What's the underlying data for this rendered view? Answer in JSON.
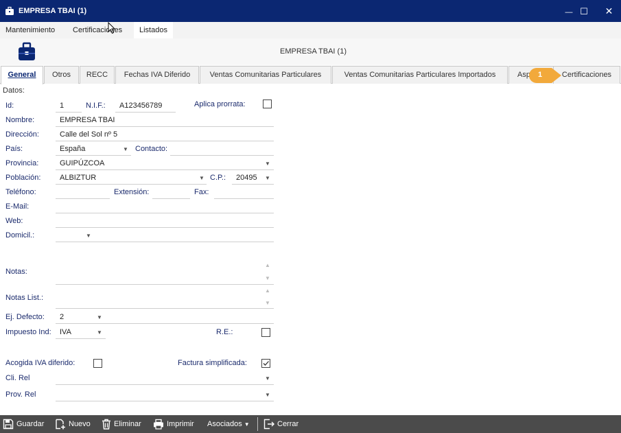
{
  "window": {
    "title": "EMPRESA TBAI (1)",
    "minimize_glyph": "—",
    "maximize_glyph": "☐",
    "close_glyph": "✕"
  },
  "menu": [
    "Mantenimiento",
    "Certificaciones",
    "Listados"
  ],
  "header": {
    "title": "EMPRESA TBAI (1)",
    "icon": "briefcase-icon"
  },
  "tabs": [
    {
      "label": "General",
      "active": true
    },
    {
      "label": "Otros"
    },
    {
      "label": "RECC"
    },
    {
      "label": "Fechas IVA Diferido"
    },
    {
      "label": "Ventas Comunitarias Particulares"
    },
    {
      "label": "Ventas Comunitarias Particulares Importados"
    },
    {
      "label": "Asp"
    },
    {
      "label": "Certificaciones"
    }
  ],
  "badge": {
    "number": "1",
    "color": "#f2a93b"
  },
  "form": {
    "section_label": "Datos:",
    "id": {
      "label": "Id:",
      "value": "1"
    },
    "nif": {
      "label": "N.I.F.:",
      "value": "A123456789"
    },
    "aplica_prorrata": {
      "label": "Aplica prorrata:",
      "checked": false
    },
    "nombre": {
      "label": "Nombre:",
      "value": "EMPRESA TBAI"
    },
    "direccion": {
      "label": "Dirección:",
      "value": "Calle del Sol nº 5"
    },
    "pais": {
      "label": "País:",
      "value": "España"
    },
    "contacto": {
      "label": "Contacto:",
      "value": ""
    },
    "provincia": {
      "label": "Provincia:",
      "value": "GUIPÚZCOA"
    },
    "poblacion": {
      "label": "Población:",
      "value": "ALBIZTUR"
    },
    "cp": {
      "label": "C.P.:",
      "value": "20495"
    },
    "telefono": {
      "label": "Teléfono:",
      "value": ""
    },
    "extension": {
      "label": "Extensión:",
      "value": ""
    },
    "fax": {
      "label": "Fax:",
      "value": ""
    },
    "email": {
      "label": "E-Mail:",
      "value": ""
    },
    "web": {
      "label": "Web:",
      "value": ""
    },
    "domicil": {
      "label": "Domicil.:",
      "value": ""
    },
    "notas": {
      "label": "Notas:",
      "value": ""
    },
    "notas_list": {
      "label": "Notas List.:",
      "value": ""
    },
    "ej_defecto": {
      "label": "Ej. Defecto:",
      "value": "2"
    },
    "impuesto_ind": {
      "label": "Impuesto Ind:",
      "value": "IVA"
    },
    "re": {
      "label": "R.E.:",
      "checked": false
    },
    "acogida_iva": {
      "label": "Acogida IVA diferido:",
      "checked": false
    },
    "factura_simplificada": {
      "label": "Factura simplificada:",
      "checked": true
    },
    "cli_rel": {
      "label": "Cli. Rel",
      "value": ""
    },
    "prov_rel": {
      "label": "Prov. Rel",
      "value": ""
    }
  },
  "toolbar": {
    "guardar": "Guardar",
    "nuevo": "Nuevo",
    "eliminar": "Eliminar",
    "imprimir": "Imprimir",
    "asociados": "Asociados",
    "cerrar": "Cerrar"
  },
  "colors": {
    "titlebar": "#0b2772",
    "label": "#1a2a6c",
    "toolbar": "#4b4b4b"
  }
}
